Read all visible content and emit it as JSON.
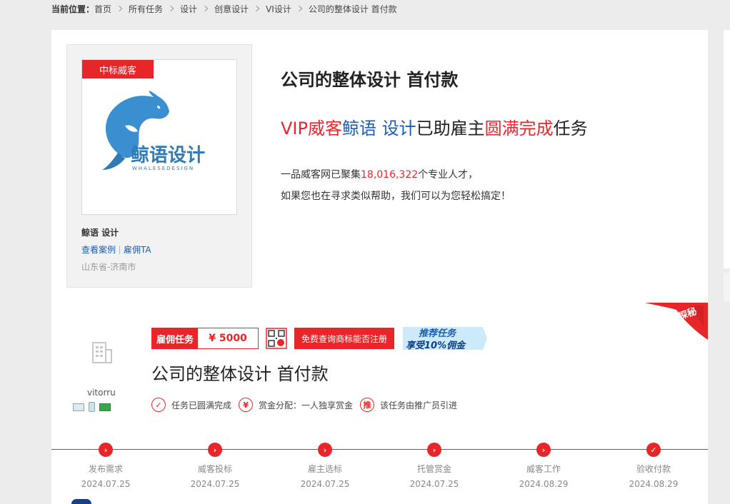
{
  "breadcrumb": {
    "label": "当前位置：",
    "items": [
      "首页",
      "所有任务",
      "设计",
      "创意设计",
      "VI设计",
      "公司的整体设计 首付款"
    ]
  },
  "shop": {
    "badge": "中标威客",
    "logo_text": "鲸语设计",
    "logo_subtext": "WHALESEDESIGN",
    "name": "鲸语 设计",
    "link_cases": "查看案例",
    "link_hire": "雇佣TA",
    "location": "山东省-济南市"
  },
  "promo": {
    "title": "公司的整体设计 首付款",
    "line_vip": "VIP威客",
    "line_name": "鲸语 设计",
    "line_mid": "已助雇主",
    "line_done": "圆满完成",
    "line_end": "任务",
    "text1_pre": "一品威客网已聚集",
    "text1_num": "18,016,322",
    "text1_post": "个专业人才，",
    "text2": "如果您也在寻求类似帮助，我们可以为您轻松搞定！"
  },
  "task": {
    "employer_name": "vitorru",
    "hire_label": "雇佣任务",
    "amount": "¥ 5000",
    "query_button": "免费查询商标能否注册",
    "rec_line1": "推荐任务",
    "rec_line2": "享受10%佣金",
    "corner_text": "探秘",
    "title": "公司的整体设计 首付款",
    "info": [
      {
        "icon": "✓",
        "text": "任务已圆满完成"
      },
      {
        "icon": "¥",
        "text": "赏金分配：一人独享赏金"
      },
      {
        "icon": "推",
        "text": "该任务由推广员引进"
      }
    ],
    "steps": [
      {
        "name": "发布需求",
        "date": "2024.07.25",
        "icon": "›"
      },
      {
        "name": "威客投标",
        "date": "2024.07.25",
        "icon": "›"
      },
      {
        "name": "雇主选标",
        "date": "2024.07.25",
        "icon": "›"
      },
      {
        "name": "托管赏金",
        "date": "2024.07.25",
        "icon": "›"
      },
      {
        "name": "威客工作",
        "date": "2024.08.29",
        "icon": "›"
      },
      {
        "name": "验收付款",
        "date": "2024.08.29",
        "icon": "✓"
      }
    ]
  },
  "colors": {
    "accent": "#e8262a",
    "link": "#1a5fb4",
    "background": "#ececec"
  }
}
